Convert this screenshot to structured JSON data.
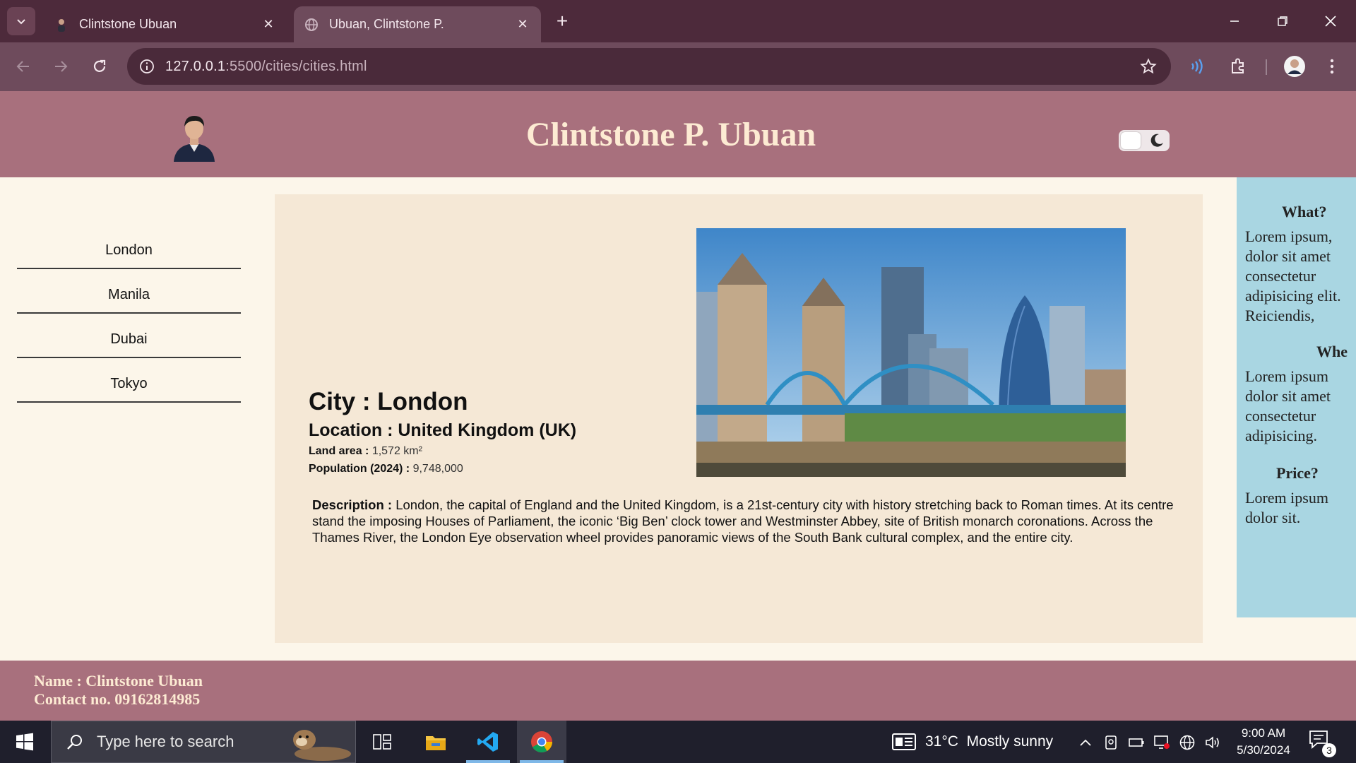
{
  "browser": {
    "tabs": [
      {
        "title": "Clintstone Ubuan",
        "active": false
      },
      {
        "title": "Ubuan, Clintstone P.",
        "active": true
      }
    ],
    "url_host": "127.0.0.1",
    "url_path": ":5500/cities/cities.html",
    "icons": [
      "tab-list-icon",
      "new-tab-icon",
      "minimize-icon",
      "restore-icon",
      "close-window-icon",
      "back-icon",
      "forward-icon",
      "reload-icon",
      "site-info-icon",
      "bookmark-star-icon",
      "read-aloud-icon",
      "extensions-icon",
      "profile-icon",
      "menu-icon"
    ]
  },
  "header": {
    "title": "Clintstone P. Ubuan",
    "theme_toggle": "dark-mode-toggle"
  },
  "sidebar": {
    "items": [
      {
        "label": "London"
      },
      {
        "label": "Manila"
      },
      {
        "label": "Dubai"
      },
      {
        "label": "Tokyo"
      }
    ]
  },
  "main": {
    "city": "City : London",
    "location": "Location : United Kingdom (UK)",
    "land_area_label": "Land area :",
    "land_area_value": "1,572 km²",
    "population_label": "Population (2024) :",
    "population_value": "9,748,000",
    "description_label": "Description :",
    "description_text": "London, the capital of England and the United Kingdom, is a 21st-century city with history stretching back to Roman times. At its centre stand the imposing Houses of Parliament, the iconic ‘Big Ben’ clock tower and Westminster Abbey, site of British monarch coronations. Across the Thames River, the London Eye observation wheel provides panoramic views of the South Bank cultural complex, and the entire city."
  },
  "aside": {
    "what_heading": "What?",
    "what_text": "Lorem ipsum, dolor sit amet consectetur adipisicing elit. Reiciendis,",
    "where_heading": "Whe",
    "where_text": "Lorem ipsum dolor sit amet consectetur adipisicing.",
    "price_heading": "Price?",
    "price_text": "Lorem ipsum dolor sit."
  },
  "footer": {
    "name": "Name : Clintstone Ubuan",
    "contact": "Contact no. 09162814985"
  },
  "taskbar": {
    "search_placeholder": "Type here to search",
    "weather": "31°C  Mostly sunny",
    "time": "9:00 AM",
    "date": "5/30/2024",
    "notification_count": "3"
  },
  "colors": {
    "chrome_tabstrip": "#4d2a3b",
    "chrome_toolbar": "#6e4b5c",
    "header_bg": "#a8707d",
    "title_color": "#fdebd3",
    "page_bg": "#fcf6ea",
    "card_bg": "#f5e8d6",
    "aside_bg": "#a9d6e2",
    "taskbar_bg": "#1f1f2c"
  }
}
